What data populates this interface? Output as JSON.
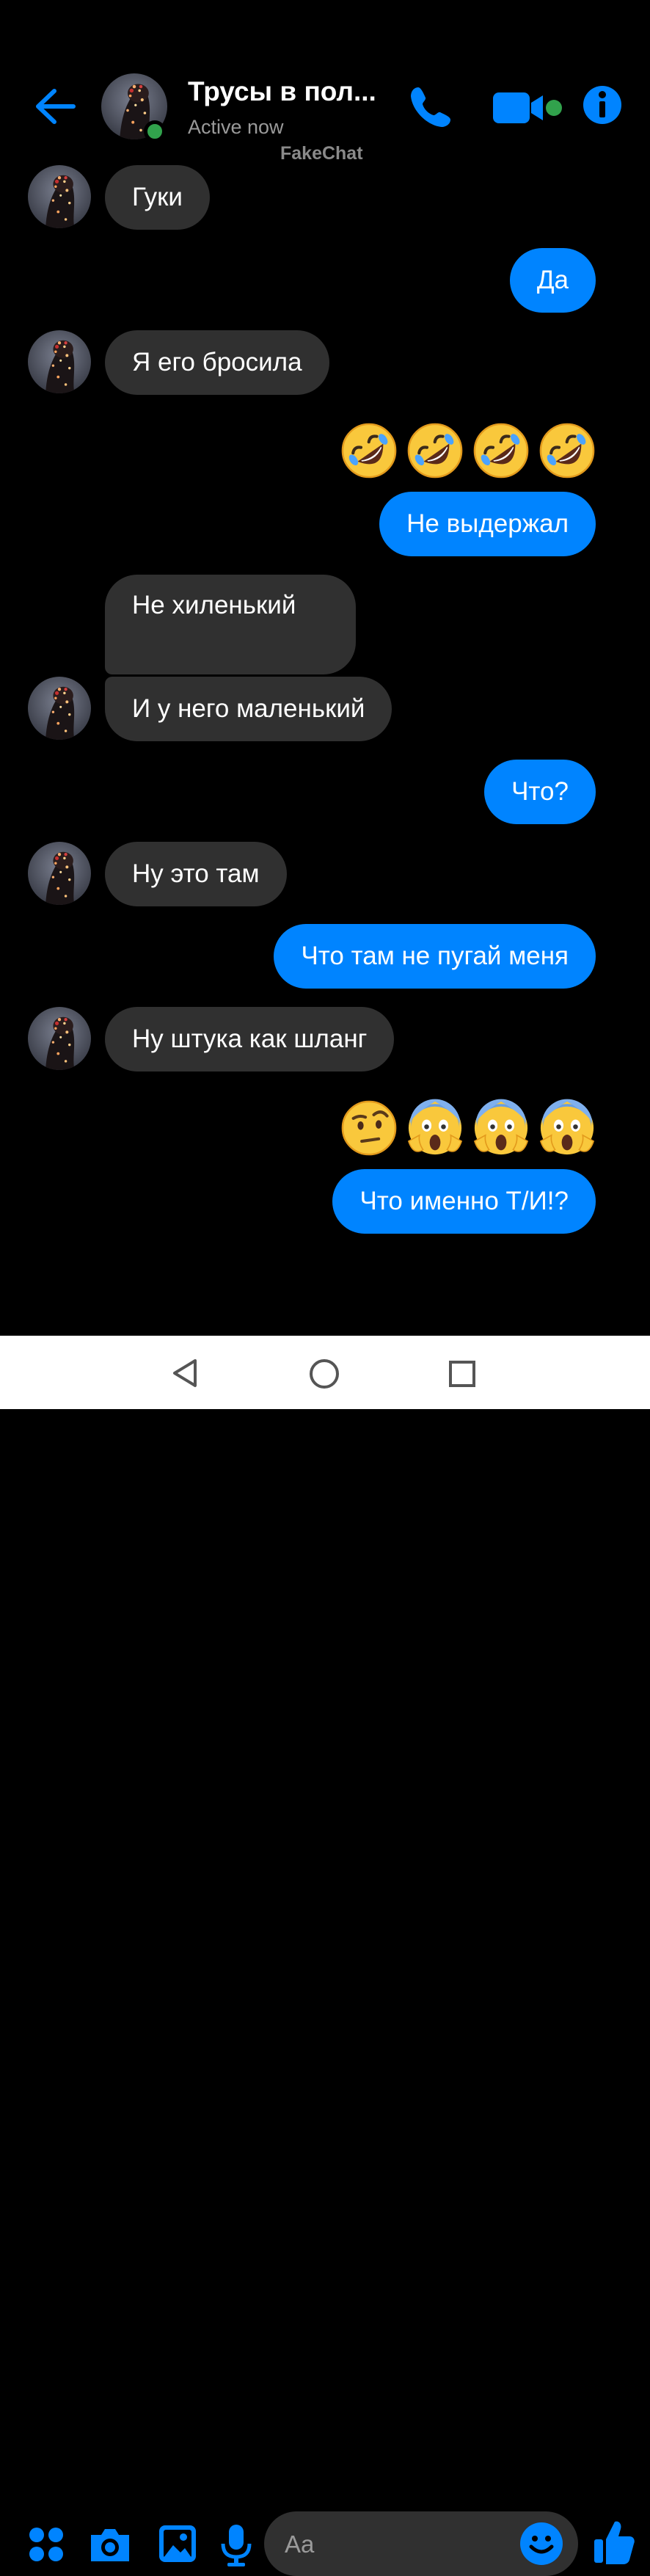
{
  "header": {
    "title": "Трусы в пол...",
    "status": "Active now",
    "watermark": "FakeChat"
  },
  "messages": {
    "m1": "Гуки",
    "m2": "Да",
    "m3": "Я его бросила",
    "m4": "Не выдержал",
    "m5": "Не хиленький",
    "m6": "И у него маленький",
    "m7": "Что?",
    "m8": "Ну это там",
    "m9": "Что там не пугай меня",
    "m10": "Ну штука как шланг",
    "m11": "Что именно Т/И!?"
  },
  "reactions": {
    "row1": [
      "rolling-laughing-emoji",
      "rolling-laughing-emoji",
      "rolling-laughing-emoji",
      "rolling-laughing-emoji"
    ],
    "row2": [
      "raised-eyebrow-emoji",
      "screaming-fear-emoji",
      "screaming-fear-emoji",
      "screaming-fear-emoji"
    ]
  },
  "composer": {
    "placeholder": "Aa"
  },
  "colors": {
    "accent": "#0084ff",
    "incoming_bubble": "#303030",
    "online": "#31a24c",
    "background": "#000000"
  },
  "icons": [
    "back-arrow-icon",
    "phone-icon",
    "video-icon",
    "info-icon",
    "apps-icon",
    "camera-icon",
    "gallery-icon",
    "mic-icon",
    "smile-icon",
    "thumbs-up-icon",
    "nav-back-icon",
    "nav-home-icon",
    "nav-recents-icon"
  ]
}
